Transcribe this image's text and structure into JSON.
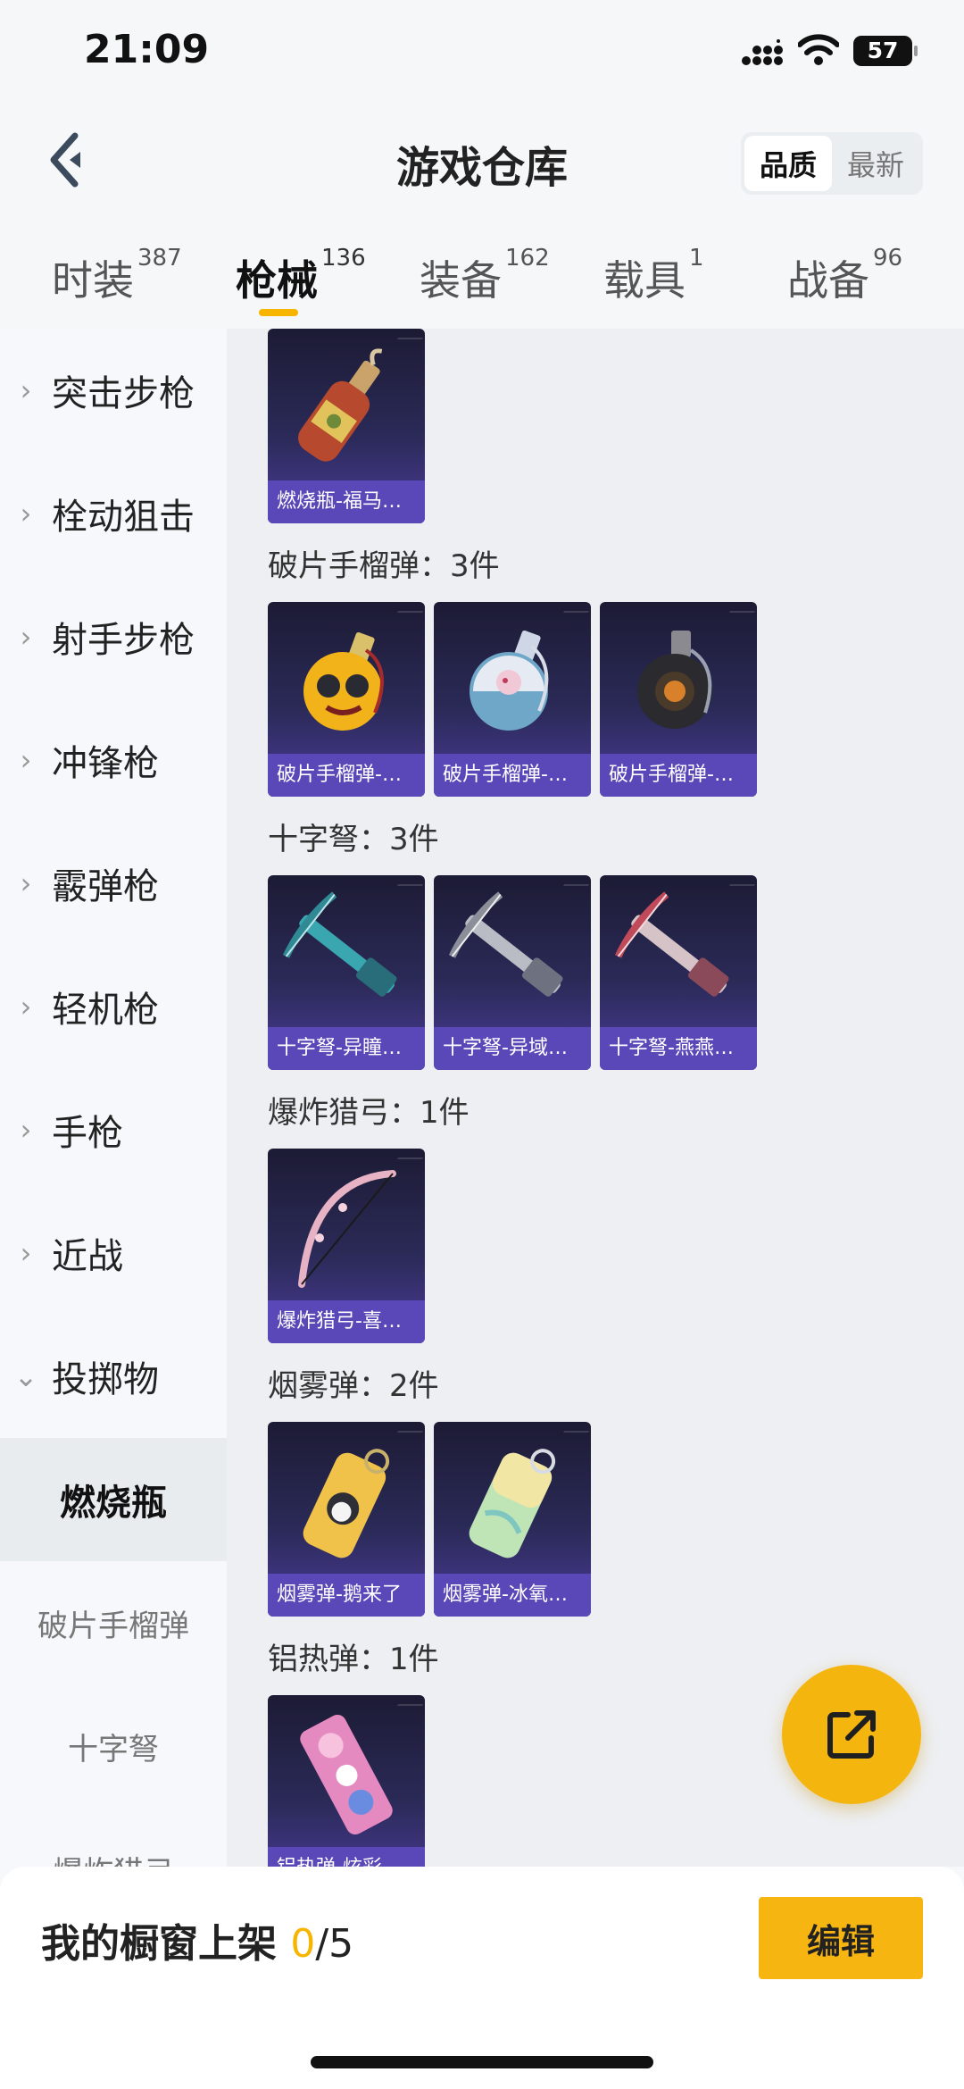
{
  "status_bar": {
    "time": "21:09",
    "battery": "57"
  },
  "header": {
    "title": "游戏仓库",
    "sort": [
      {
        "label": "品质",
        "active": true
      },
      {
        "label": "最新",
        "active": false
      }
    ]
  },
  "tabs": [
    {
      "label": "时装",
      "count": "387"
    },
    {
      "label": "枪械",
      "count": "136"
    },
    {
      "label": "装备",
      "count": "162"
    },
    {
      "label": "载具",
      "count": "1"
    },
    {
      "label": "战备",
      "count": "96"
    }
  ],
  "sidebar": {
    "items": [
      {
        "label": "突击步枪"
      },
      {
        "label": "栓动狙击"
      },
      {
        "label": "射手步枪"
      },
      {
        "label": "冲锋枪"
      },
      {
        "label": "霰弹枪"
      },
      {
        "label": "轻机枪"
      },
      {
        "label": "手枪"
      },
      {
        "label": "近战"
      },
      {
        "label": "投掷物"
      }
    ],
    "sub_items": [
      {
        "label": "燃烧瓶"
      },
      {
        "label": "破片手榴弹"
      },
      {
        "label": "十字弩"
      },
      {
        "label": "爆炸猎弓"
      }
    ]
  },
  "groups": [
    {
      "title": "",
      "items": [
        {
          "label": "燃烧瓶-福马…",
          "icon": "molotov-icon"
        }
      ]
    },
    {
      "title": "破片手榴弹：3件",
      "items": [
        {
          "label": "破片手榴弹-…",
          "icon": "grenade-yellow-icon"
        },
        {
          "label": "破片手榴弹-…",
          "icon": "grenade-white-icon"
        },
        {
          "label": "破片手榴弹-…",
          "icon": "grenade-black-icon"
        }
      ]
    },
    {
      "title": "十字弩：3件",
      "items": [
        {
          "label": "十字弩-异瞳…",
          "icon": "crossbow-teal-icon"
        },
        {
          "label": "十字弩-异域…",
          "icon": "crossbow-gray-icon"
        },
        {
          "label": "十字弩-燕燕…",
          "icon": "crossbow-pink-icon"
        }
      ]
    },
    {
      "title": "爆炸猎弓：1件",
      "items": [
        {
          "label": "爆炸猎弓-喜…",
          "icon": "bow-icon"
        }
      ]
    },
    {
      "title": "烟雾弹：2件",
      "items": [
        {
          "label": "烟雾弹-鹅来了",
          "icon": "smoke-yellow-icon"
        },
        {
          "label": "烟雾弹-冰氧…",
          "icon": "smoke-green-icon"
        }
      ]
    },
    {
      "title": "铝热弹：1件",
      "items": [
        {
          "label": "铝热弹-炫彩…",
          "icon": "thermite-icon"
        }
      ]
    }
  ],
  "bottom": {
    "showcase_label": "我的橱窗上架",
    "current": "0",
    "separator": "/",
    "max": "5",
    "edit_label": "编辑"
  },
  "colors": {
    "accent": "#f7b500",
    "card_label": "#5a47b8",
    "card_bg": "#2b2a58"
  }
}
